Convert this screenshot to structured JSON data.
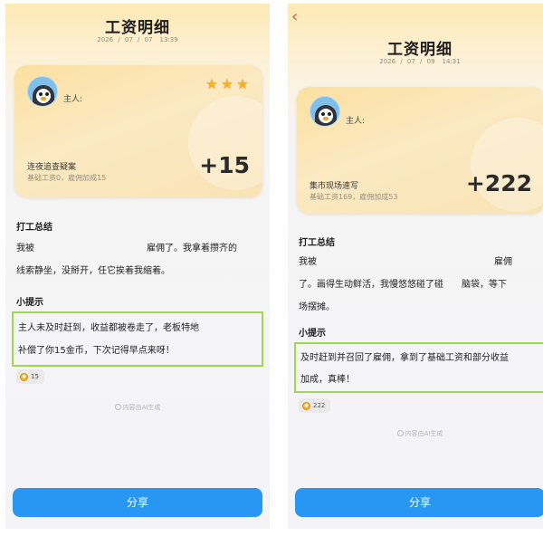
{
  "colors": {
    "accent_blue": "#2897f3",
    "highlight_green": "#9fd84a",
    "back_arrow": "#e0543c",
    "star_gold": "#f5b324"
  },
  "left": {
    "title": "工资明细",
    "date": "2026 / 07 / 07",
    "time": "13:39",
    "owner_label": "主人:",
    "stars": [
      "★",
      "★",
      "★"
    ],
    "star_count": 3,
    "job_name": "连夜追查疑案",
    "job_detail": "基础工资0，雇佣加成15",
    "earnings": "+15",
    "summary_title": "打工总结",
    "summary_line1_a": "我被",
    "summary_line1_b": "雇佣了。我拿着攒齐的",
    "summary_line2": "线索静坐，没掰开，任它挨着我缩着。",
    "tip_title": "小提示",
    "tip_line1_a": "主人未及时赶到，收益都被",
    "tip_line1_b": "卷走了，老板特地",
    "tip_line2": "补偿了你15金币，下次记得早点来呀！",
    "coin_amount": "15",
    "ai_note": "内容由AI生成",
    "share_label": "分享"
  },
  "right": {
    "back_icon": "‹",
    "title": "工资明细",
    "date": "2026 / 07 / 09",
    "time": "14:31",
    "owner_label": "主人:",
    "job_name": "集市现场速写",
    "job_detail": "基础工资169，雇佣加成53",
    "earnings": "+222",
    "summary_title": "打工总结",
    "summary_line1_a": "我被",
    "summary_line1_b": "雇佣",
    "summary_line2_a": "了。画得生动鲜活，我慢悠悠碰了碰",
    "summary_line2_b": "脑袋，等下",
    "summary_line3": "场摆摊。",
    "tip_title": "小提示",
    "tip_line1": "及时赶到并召回了雇佣，拿到了基础工资和部分收益",
    "tip_line2": "加成，真棒！",
    "coin_amount": "222",
    "ai_note": "内容由AI生成",
    "share_label": "分享"
  }
}
